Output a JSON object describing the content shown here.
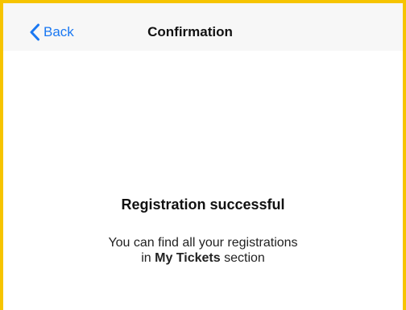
{
  "nav": {
    "back_label": "Back",
    "title": "Confirmation"
  },
  "content": {
    "headline": "Registration successful",
    "message_line1": "You can find all your registrations",
    "message_in": "in",
    "message_link": "My Tickets",
    "message_suffix": "section"
  },
  "colors": {
    "accent": "#1a78f2",
    "frame": "#f6c400",
    "navbar_bg": "#f7f7f7"
  },
  "icons": {
    "back": "chevron-left-icon"
  }
}
